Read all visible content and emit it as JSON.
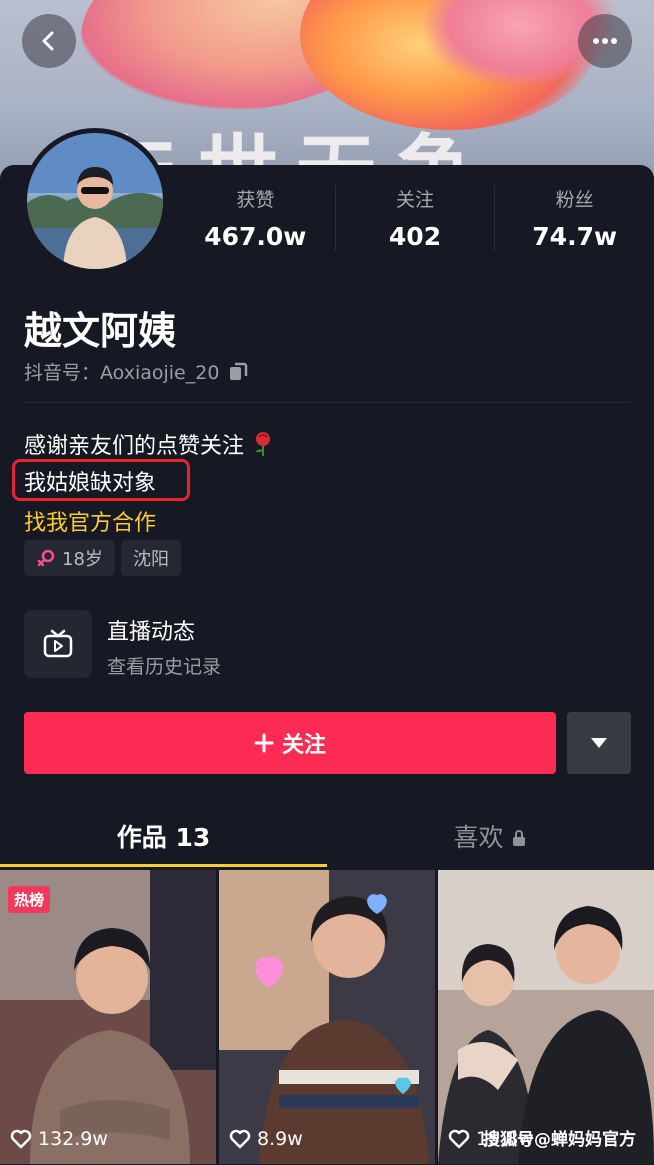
{
  "cover": {
    "big_text": "与世无争"
  },
  "stats": [
    {
      "label": "获赞",
      "value": "467.0w"
    },
    {
      "label": "关注",
      "value": "402"
    },
    {
      "label": "粉丝",
      "value": "74.7w"
    }
  ],
  "profile": {
    "name": "越文阿姨",
    "douyin_id": "抖音号：Aoxiaojie_20",
    "bio_line1": "感谢亲友们的点赞关注",
    "bio_line2": "我姑娘缺对象",
    "bio_line3": "找我官方合作",
    "tag_age": "18岁",
    "tag_city": "沈阳"
  },
  "live": {
    "title": "直播动态",
    "subtitle": "查看历史记录"
  },
  "actions": {
    "follow_label": "关注"
  },
  "tabs": {
    "works": "作品 13",
    "likes": "喜欢"
  },
  "videos": [
    {
      "likes": "132.9w",
      "badge": "热榜"
    },
    {
      "likes": "8.9w"
    },
    {
      "likes": "15.8w"
    }
  ],
  "watermark": "搜狐号@蝉妈妈官方",
  "colors": {
    "accent": "#fe2c55",
    "tab_indicator": "#facd2a",
    "bio_link": "#facd2a",
    "highlight_box": "#e8232a"
  }
}
